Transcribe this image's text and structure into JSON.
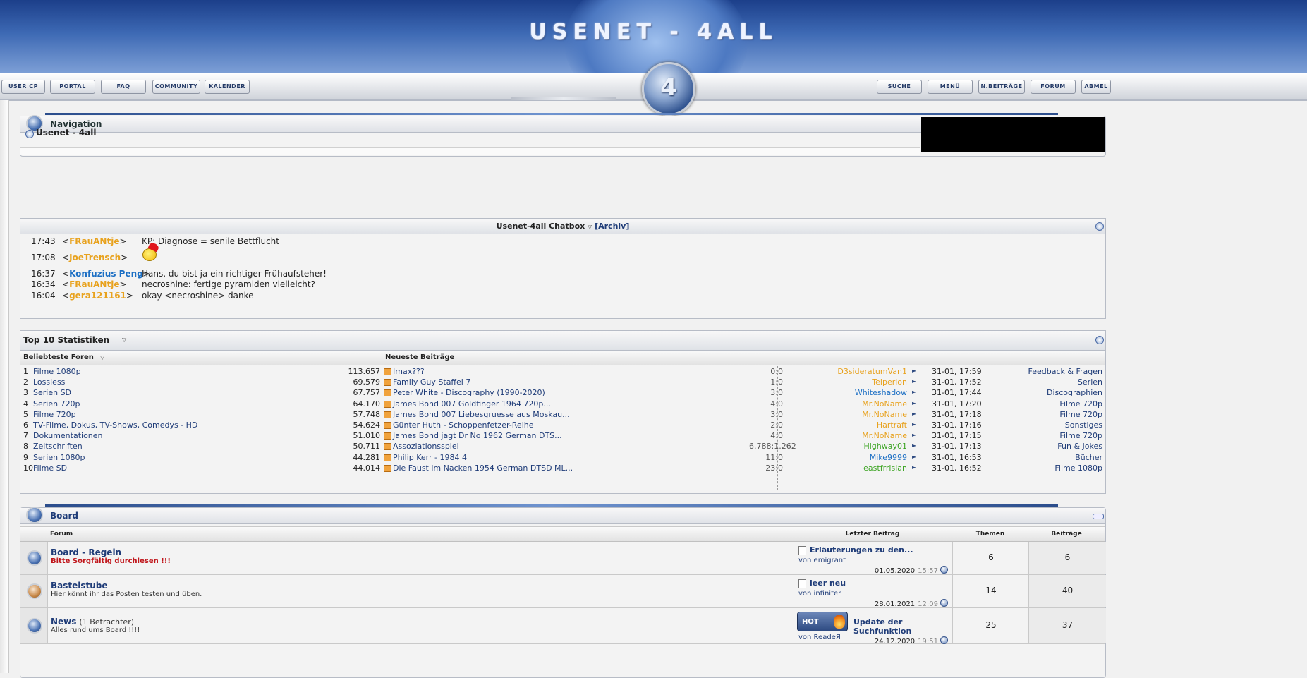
{
  "header": {
    "logo": "USENET - 4ALL",
    "emblem": "4"
  },
  "nav": {
    "left": [
      "USER CP",
      "PORTAL",
      "FAQ",
      "COMMUNITY",
      "KALENDER"
    ],
    "right": [
      "SUCHE",
      "MENÜ",
      "N.BEITRÄGE",
      "FORUM",
      "ABMEL"
    ]
  },
  "navigation_panel": {
    "title": "Navigation",
    "breadcrumb": "Usenet - 4all"
  },
  "chatbox": {
    "title": "Usenet-4all Chatbox",
    "archive": "[Archiv]",
    "messages": [
      {
        "time": "17:43",
        "user": "FRauANtje",
        "text": "KP: Diagnose = senile Bettflucht"
      },
      {
        "time": "17:08",
        "user": "JoeTrensch",
        "text": ""
      },
      {
        "time": "16:37",
        "user": "Konfuzius Peng",
        "text": "Hans, du bist ja ein richtiger Frühaufsteher!"
      },
      {
        "time": "16:34",
        "user": "FRauANtje",
        "text": "necroshine: fertige pyramiden vielleicht?"
      },
      {
        "time": "16:04",
        "user": "gera121161",
        "text": "okay <necroshine> danke"
      }
    ],
    "user_colors": {
      "FRauANtje": "#e8a21e",
      "JoeTrensch": "#e8a21e",
      "Konfuzius Peng": "#1c6fc4",
      "gera121161": "#e8a21e"
    }
  },
  "top10": {
    "title": "Top 10 Statistiken",
    "left_header": "Beliebteste Foren",
    "right_header": "Neueste Beiträge",
    "forums": [
      {
        "rank": "1",
        "name": "Filme 1080p",
        "value": "113.657"
      },
      {
        "rank": "2",
        "name": "Lossless",
        "value": "69.579"
      },
      {
        "rank": "3",
        "name": "Serien SD",
        "value": "67.757"
      },
      {
        "rank": "4",
        "name": "Serien 720p",
        "value": "64.170"
      },
      {
        "rank": "5",
        "name": "Filme 720p",
        "value": "57.748"
      },
      {
        "rank": "6",
        "name": "TV-Filme, Dokus, TV-Shows, Comedys - HD",
        "value": "54.624"
      },
      {
        "rank": "7",
        "name": "Dokumentationen",
        "value": "51.010"
      },
      {
        "rank": "8",
        "name": "Zeitschriften",
        "value": "50.711"
      },
      {
        "rank": "9",
        "name": "Serien 1080p",
        "value": "44.281"
      },
      {
        "rank": "10",
        "name": "Filme SD",
        "value": "44.014"
      }
    ],
    "posts": [
      {
        "title": "Imax???",
        "replies": "0",
        "views": "0",
        "user": "D3sideratumVan1",
        "ucolor": "#e8a21e",
        "date": "31-01, 17:59",
        "forum": "Feedback & Fragen"
      },
      {
        "title": "Family Guy Staffel 7",
        "replies": "1",
        "views": "0",
        "user": "Telperion",
        "ucolor": "#e8a21e",
        "date": "31-01, 17:52",
        "forum": "Serien"
      },
      {
        "title": "Peter White - Discography (1990-2020)",
        "replies": "3",
        "views": "0",
        "user": "Whiteshadow",
        "ucolor": "#1c6fc4",
        "date": "31-01, 17:44",
        "forum": "Discographien"
      },
      {
        "title": "James Bond 007 Goldfinger 1964 720p...",
        "replies": "4",
        "views": "0",
        "user": "Mr.NoName",
        "ucolor": "#e8a21e",
        "date": "31-01, 17:20",
        "forum": "Filme 720p"
      },
      {
        "title": "James Bond 007 Liebesgruesse aus Moskau...",
        "replies": "3",
        "views": "0",
        "user": "Mr.NoName",
        "ucolor": "#e8a21e",
        "date": "31-01, 17:18",
        "forum": "Filme 720p"
      },
      {
        "title": "Günter Huth - Schoppenfetzer-Reihe",
        "replies": "2",
        "views": "0",
        "user": "Hartraft",
        "ucolor": "#e8a21e",
        "date": "31-01, 17:16",
        "forum": "Sonstiges"
      },
      {
        "title": "James Bond jagt Dr No 1962 German DTS...",
        "replies": "4",
        "views": "0",
        "user": "Mr.NoName",
        "ucolor": "#e8a21e",
        "date": "31-01, 17:15",
        "forum": "Filme 720p"
      },
      {
        "title": "Assoziationsspiel",
        "replies": "6.788",
        "views": "1.262",
        "user": "Highway01",
        "ucolor": "#3aa321",
        "date": "31-01, 17:13",
        "forum": "Fun & Jokes"
      },
      {
        "title": "Philip Kerr - 1984 4",
        "replies": "11",
        "views": "0",
        "user": "Mike9999",
        "ucolor": "#1c6fc4",
        "date": "31-01, 16:53",
        "forum": "Bücher"
      },
      {
        "title": "Die Faust im Nacken 1954 German DTSD ML...",
        "replies": "23",
        "views": "0",
        "user": "eastfrrisian",
        "ucolor": "#3aa321",
        "date": "31-01, 16:52",
        "forum": "Filme 1080p"
      }
    ]
  },
  "board": {
    "title": "Board",
    "headers": {
      "forum": "Forum",
      "last": "Letzter Beitrag",
      "threads": "Themen",
      "posts": "Beiträge"
    },
    "rows": [
      {
        "name": "Board - Regeln",
        "extra": "",
        "desc": "Bitte Sorgfältig durchlesen !!!",
        "desc_color": "#c0161b",
        "last_title": "Erläuterungen zu den...",
        "last_by": "von emigrant",
        "last_date": "01.05.2020",
        "last_time": "15:57",
        "threads": "6",
        "posts": "6",
        "hot": false
      },
      {
        "name": "Bastelstube",
        "extra": "",
        "desc": "Hier könnt ihr das Posten testen und üben.",
        "desc_color": "#333333",
        "last_title": "leer neu",
        "last_by": "von infiniter",
        "last_date": "28.01.2021",
        "last_time": "12:09",
        "threads": "14",
        "posts": "40",
        "hot": false
      },
      {
        "name": "News",
        "extra": "(1 Betrachter)",
        "desc": "Alles rund ums Board !!!!",
        "desc_color": "#333333",
        "last_title": "Update der Suchfunktion",
        "last_by": "von ReadeЯ",
        "last_date": "24.12.2020",
        "last_time": "19:51",
        "threads": "25",
        "posts": "37",
        "hot": true,
        "hot_label": "HOT"
      }
    ]
  }
}
